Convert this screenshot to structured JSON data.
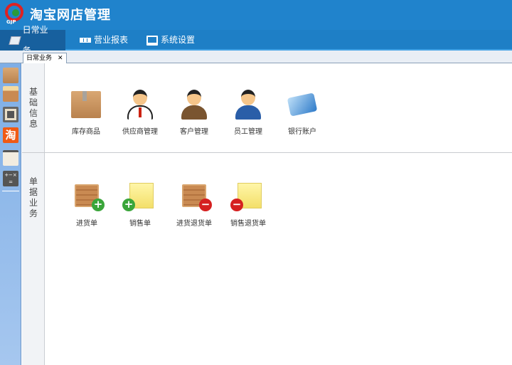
{
  "app": {
    "title": "淘宝网店管理",
    "logo_text": "GJP"
  },
  "nav": {
    "tabs": [
      {
        "label": "日常业务",
        "active": true
      },
      {
        "label": "营业报表"
      },
      {
        "label": "系统设置"
      }
    ]
  },
  "doc_tab": {
    "label": "日常业务",
    "close": "✕"
  },
  "sections": [
    {
      "label": "基础信息",
      "items": [
        {
          "label": "库存商品"
        },
        {
          "label": "供应商管理"
        },
        {
          "label": "客户管理"
        },
        {
          "label": "员工管理"
        },
        {
          "label": "银行账户"
        }
      ]
    },
    {
      "label": "单据业务",
      "items": [
        {
          "label": "进货单"
        },
        {
          "label": "销售单"
        },
        {
          "label": "进货退货单"
        },
        {
          "label": "销售退货单"
        }
      ]
    }
  ],
  "sidebar": {
    "taobao_glyph": "淘",
    "calc_glyph": "+−×="
  },
  "colors": {
    "header": "#2083cc",
    "nav_active": "#17609e"
  }
}
